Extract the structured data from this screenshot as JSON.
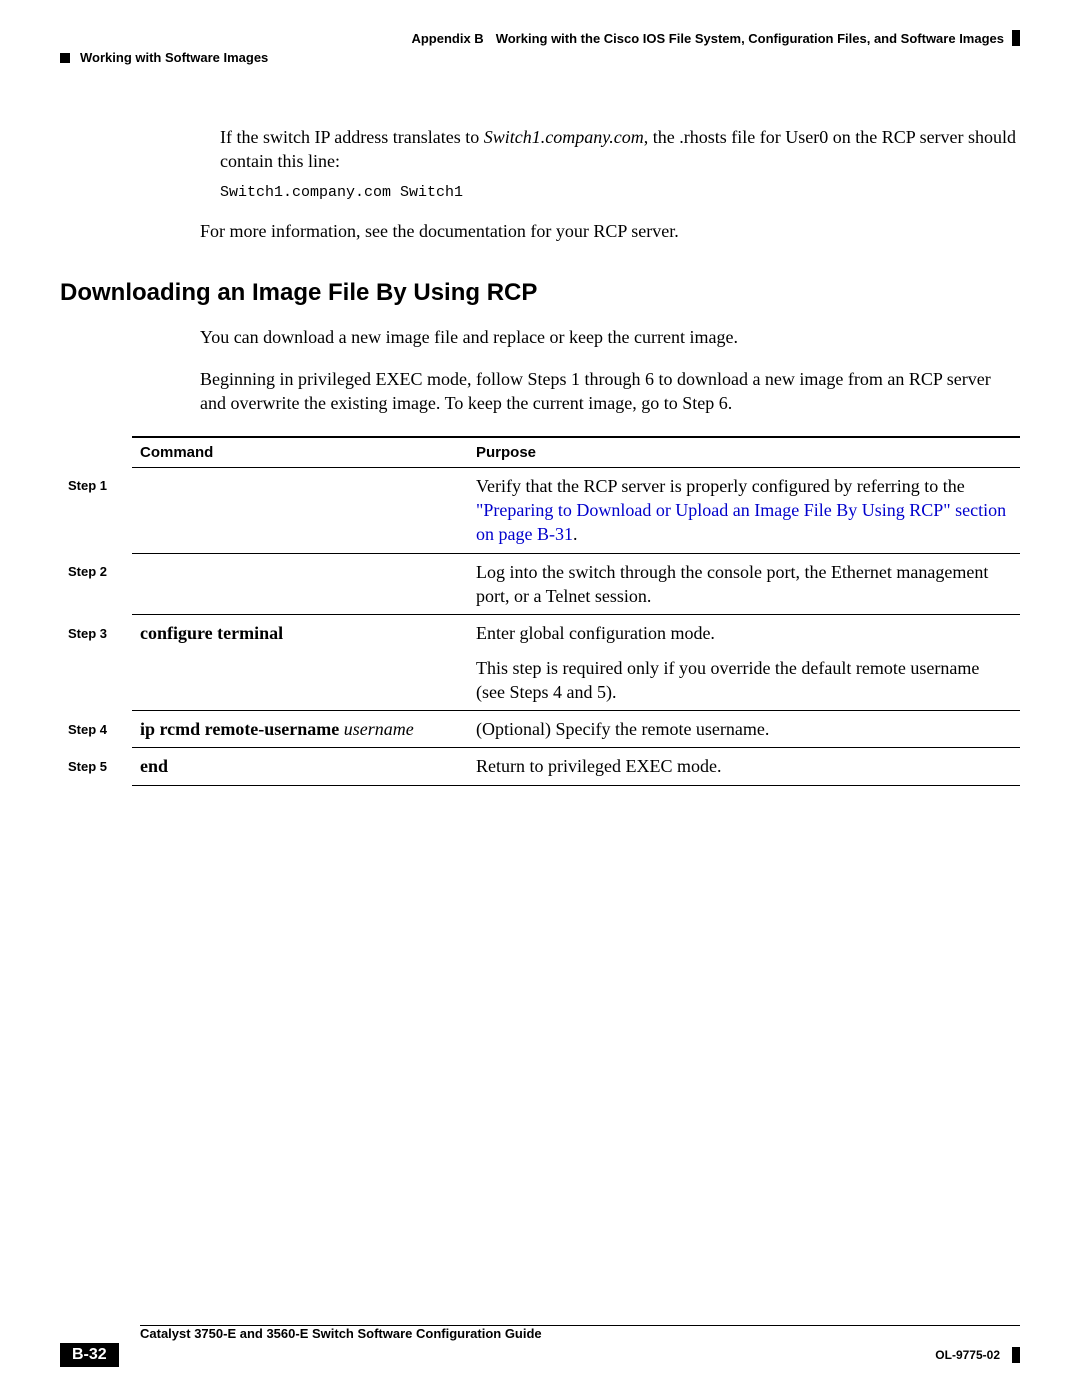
{
  "header": {
    "appendix_label": "Appendix B",
    "appendix_title": "Working with the Cisco IOS File System, Configuration Files, and Software Images",
    "section_breadcrumb": "Working with Software Images"
  },
  "intro": {
    "p1_pre": "If the switch IP address translates to ",
    "p1_italic": "Switch1.company.com",
    "p1_post": ", the .rhosts file for User0 on the RCP server should contain this line:",
    "code": "Switch1.company.com Switch1",
    "p2": "For more information, see the documentation for your RCP server."
  },
  "section": {
    "title": "Downloading an Image File By Using RCP",
    "p1": "You can download a new image file and replace or keep the current image.",
    "p2": "Beginning in privileged EXEC mode, follow Steps 1 through 6 to download a new image from an RCP server and overwrite the existing image. To keep the current image, go to Step 6."
  },
  "table": {
    "head_command": "Command",
    "head_purpose": "Purpose",
    "rows": [
      {
        "step": "Step 1",
        "command": "",
        "purpose_pre": "Verify that the RCP server is properly configured by referring to the ",
        "purpose_link": "\"Preparing to Download or Upload an Image File By Using RCP\" section on page B-31",
        "purpose_post": "."
      },
      {
        "step": "Step 2",
        "command": "",
        "purpose": "Log into the switch through the console port, the Ethernet management port, or a Telnet session."
      },
      {
        "step": "Step 3",
        "command_bold": "configure terminal",
        "purpose": "Enter global configuration mode.",
        "purpose2": "This step is required only if you override the default remote username (see Steps 4 and 5)."
      },
      {
        "step": "Step 4",
        "command_bold": "ip rcmd remote-username",
        "command_italic": "username",
        "purpose": "(Optional) Specify the remote username."
      },
      {
        "step": "Step 5",
        "command_bold": "end",
        "purpose": "Return to privileged EXEC mode."
      }
    ]
  },
  "footer": {
    "guide_title": "Catalyst 3750-E and 3560-E Switch Software Configuration Guide",
    "page_number": "B-32",
    "doc_id": "OL-9775-02"
  }
}
